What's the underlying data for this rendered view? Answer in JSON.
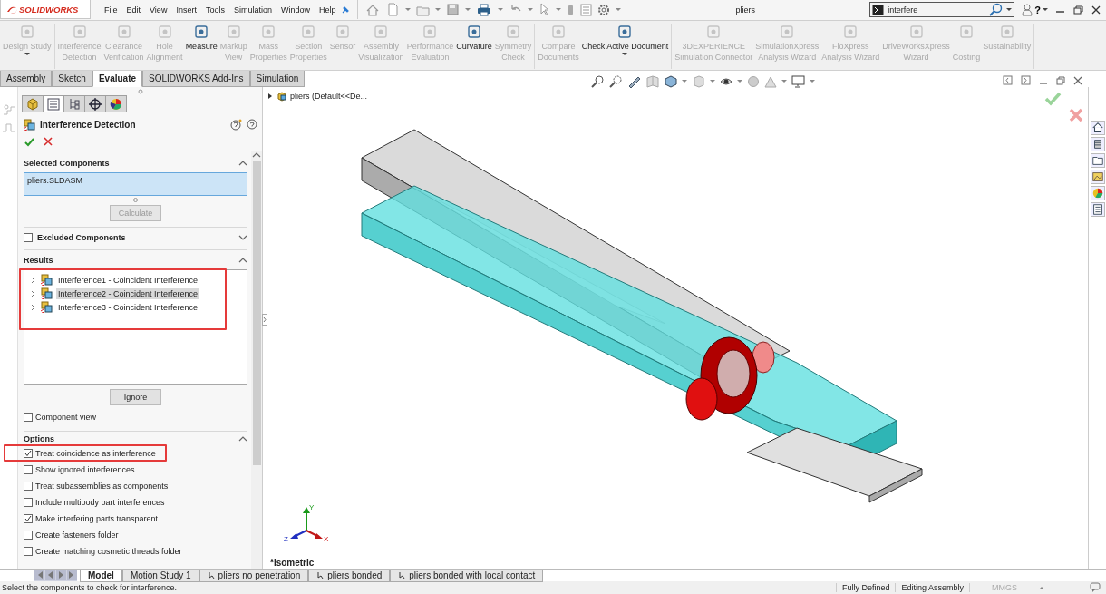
{
  "title_bar": {
    "logo": "SOLIDWORKS",
    "menu": [
      "File",
      "Edit",
      "View",
      "Insert",
      "Tools",
      "Simulation",
      "Window",
      "Help"
    ],
    "document_title": "pliers",
    "search": {
      "value": "interfere"
    },
    "help": "?"
  },
  "ribbon": {
    "groups": [
      [
        {
          "label": "Design Study",
          "disabled": true,
          "dropdown": true
        }
      ],
      [
        {
          "label": "Interference\nDetection",
          "disabled": true,
          "dropdown": false
        },
        {
          "label": "Clearance\nVerification",
          "disabled": true,
          "dropdown": false
        },
        {
          "label": "Hole\nAlignment",
          "disabled": true,
          "dropdown": false
        },
        {
          "label": "Measure",
          "disabled": false,
          "dropdown": false
        },
        {
          "label": "Markup\nView",
          "disabled": true,
          "dropdown": false
        },
        {
          "label": "Mass\nProperties",
          "disabled": true,
          "dropdown": false
        },
        {
          "label": "Section\nProperties",
          "disabled": true,
          "dropdown": false
        },
        {
          "label": "Sensor",
          "disabled": true,
          "dropdown": false
        },
        {
          "label": "Assembly\nVisualization",
          "disabled": true,
          "dropdown": false
        },
        {
          "label": "Performance\nEvaluation",
          "disabled": true,
          "dropdown": false
        },
        {
          "label": "Curvature",
          "disabled": false,
          "dropdown": false
        },
        {
          "label": "Symmetry\nCheck",
          "disabled": true,
          "dropdown": false
        }
      ],
      [
        {
          "label": "Compare\nDocuments",
          "disabled": true,
          "dropdown": false
        },
        {
          "label": "Check Active Document",
          "disabled": false,
          "dropdown": true
        }
      ],
      [
        {
          "label": "3DEXPERIENCE\nSimulation Connector",
          "disabled": true,
          "dropdown": false
        },
        {
          "label": "SimulationXpress\nAnalysis Wizard",
          "disabled": true,
          "dropdown": false
        },
        {
          "label": "FloXpress\nAnalysis Wizard",
          "disabled": true,
          "dropdown": false
        },
        {
          "label": "DriveWorksXpress\nWizard",
          "disabled": true,
          "dropdown": false
        },
        {
          "label": "\nCosting",
          "disabled": true,
          "dropdown": false
        },
        {
          "label": "Sustainability",
          "disabled": true,
          "dropdown": false
        }
      ]
    ]
  },
  "command_tabs": [
    {
      "label": "Assembly",
      "selected": false
    },
    {
      "label": "Sketch",
      "selected": false
    },
    {
      "label": "Evaluate",
      "selected": true
    },
    {
      "label": "SOLIDWORKS Add-Ins",
      "selected": false
    },
    {
      "label": "Simulation",
      "selected": false
    }
  ],
  "property_manager": {
    "tabs": [
      {
        "kind": "feature",
        "selected": false
      },
      {
        "kind": "property",
        "selected": true
      },
      {
        "kind": "configuration",
        "selected": false
      },
      {
        "kind": "dimxpert",
        "selected": false
      },
      {
        "kind": "display",
        "selected": false
      }
    ],
    "title": "Interference Detection",
    "selected_components": {
      "heading": "Selected Components",
      "expanded": true,
      "items": [
        "pliers.SLDASM"
      ],
      "button": {
        "label": "Calculate",
        "disabled": true
      }
    },
    "excluded_components": {
      "heading": "Excluded Components",
      "checked": false,
      "expanded": false
    },
    "results": {
      "heading": "Results",
      "expanded": true,
      "items": [
        {
          "label": "Interference1 - Coincident Interference",
          "selected": false,
          "expanded": false
        },
        {
          "label": "Interference2 - Coincident Interference",
          "selected": true,
          "expanded": false
        },
        {
          "label": "Interference3 - Coincident Interference",
          "selected": false,
          "expanded": false
        }
      ],
      "button": {
        "label": "Ignore",
        "disabled": false
      }
    },
    "component_view": {
      "label": "Component view",
      "checked": false
    },
    "options": {
      "heading": "Options",
      "expanded": true,
      "items": [
        {
          "label": "Treat coincidence as interference",
          "checked": true
        },
        {
          "label": "Show ignored interferences",
          "checked": false
        },
        {
          "label": "Treat subassemblies as components",
          "checked": false
        },
        {
          "label": "Include multibody part interferences",
          "checked": false
        },
        {
          "label": "Make interfering parts transparent",
          "checked": true
        },
        {
          "label": "Create fasteners folder",
          "checked": false
        },
        {
          "label": "Create matching cosmetic threads folder",
          "checked": false
        }
      ]
    }
  },
  "viewport": {
    "tree_root": "pliers (Default<<De...",
    "orientation": "*Isometric",
    "axes": [
      "X",
      "Y",
      "Z"
    ]
  },
  "bottom_tabs": [
    {
      "label": "Model",
      "selected": true,
      "kind": "model"
    },
    {
      "label": "Motion Study 1",
      "selected": false,
      "kind": "motion"
    },
    {
      "label": "pliers no penetration",
      "selected": false,
      "kind": "study"
    },
    {
      "label": "pliers bonded",
      "selected": false,
      "kind": "study"
    },
    {
      "label": "pliers bonded with local contact",
      "selected": false,
      "kind": "study"
    }
  ],
  "status_bar": {
    "message": "Select the components to check for interference.",
    "fields": [
      {
        "label": "Fully Defined",
        "disabled": false
      },
      {
        "label": "Editing Assembly",
        "disabled": false
      },
      {
        "label": "MMGS",
        "disabled": true
      }
    ]
  }
}
